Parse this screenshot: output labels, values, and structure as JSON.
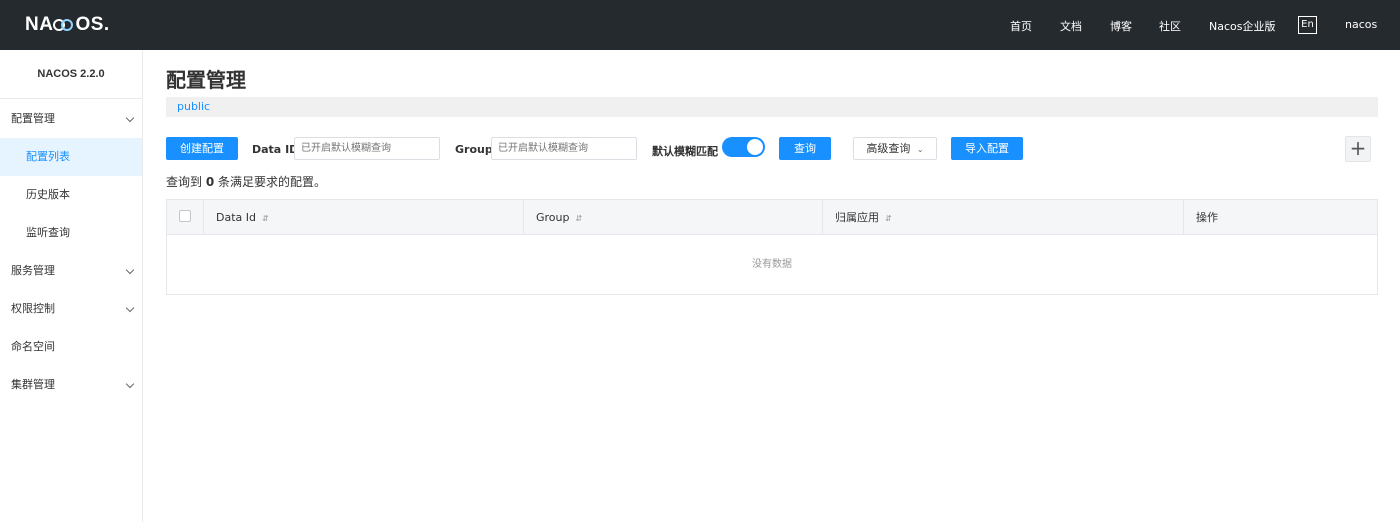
{
  "header": {
    "logo_left": "NA",
    "logo_right": "OS.",
    "nav": [
      "首页",
      "文档",
      "博客",
      "社区",
      "Nacos企业版"
    ],
    "lang": "En",
    "user": "nacos"
  },
  "sidebar": {
    "version": "NACOS 2.2.0",
    "items": [
      {
        "label": "配置管理"
      },
      {
        "label": "配置列表"
      },
      {
        "label": "历史版本"
      },
      {
        "label": "监听查询"
      },
      {
        "label": "服务管理"
      },
      {
        "label": "权限控制"
      },
      {
        "label": "命名空间"
      },
      {
        "label": "集群管理"
      }
    ]
  },
  "main": {
    "title": "配置管理",
    "namespace": "public",
    "create_btn": "创建配置",
    "data_id_label": "Data ID",
    "data_id_placeholder": "已开启默认模糊查询",
    "group_label": "Group",
    "group_placeholder": "已开启默认模糊查询",
    "fuzzy_label": "默认模糊匹配",
    "fuzzy_on": true,
    "query_btn": "查询",
    "advanced_select": "高级查询",
    "import_btn": "导入配置",
    "plus": "+",
    "count_prefix": "查询到",
    "count_value": "0",
    "count_suffix": "条满足要求的配置。",
    "table": {
      "columns": [
        "Data Id",
        "Group",
        "归属应用",
        "操作"
      ],
      "empty": "没有数据"
    }
  },
  "colors": {
    "topbar": "#252a2f",
    "primary": "#1890ff",
    "active_bg": "#e6f4ff"
  }
}
